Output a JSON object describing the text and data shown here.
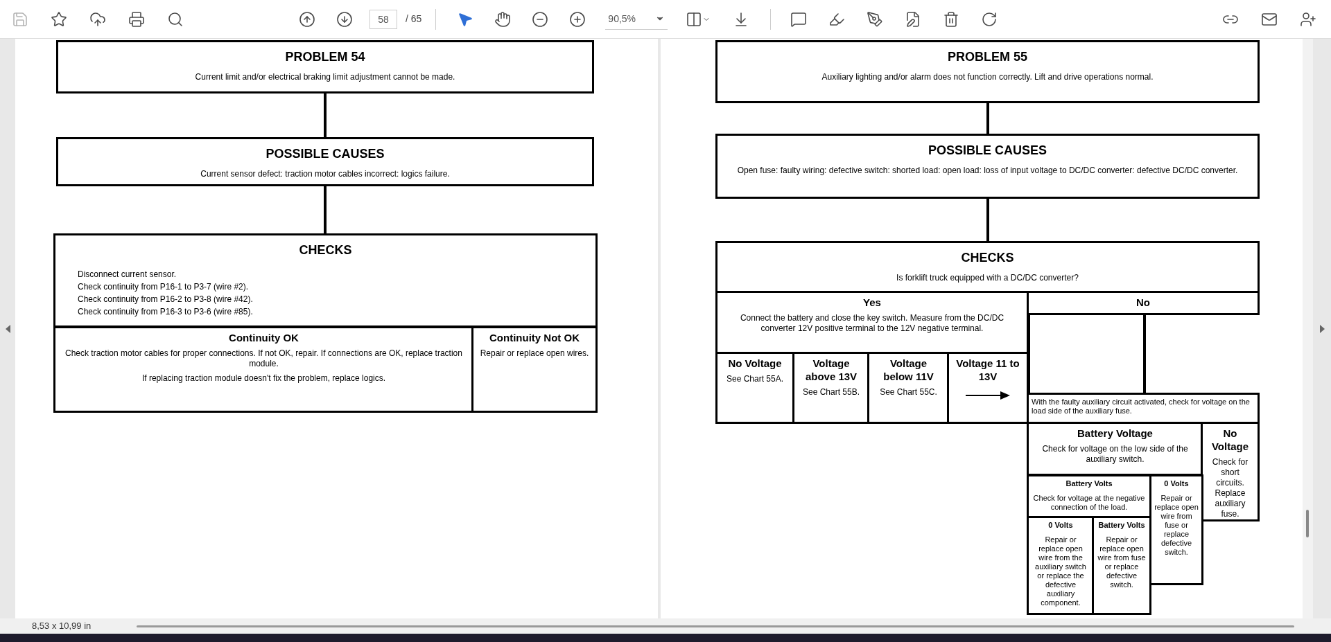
{
  "toolbar": {
    "page_field": {
      "value": "58"
    },
    "page_total": "/ 65",
    "zoom_field": {
      "value": "90,5%"
    }
  },
  "pages": [
    {
      "nodes": [
        {
          "kind": "heading",
          "title": "PROBLEM 54",
          "paragraphs": [
            "Current limit and/or electrical braking limit adjustment cannot be made."
          ]
        },
        {
          "kind": "heading",
          "title": "POSSIBLE CAUSES",
          "paragraphs": [
            "Current sensor defect: traction motor cables incorrect: logics failure."
          ]
        },
        {
          "kind": "heading",
          "title": "CHECKS",
          "lines": [
            "Disconnect current sensor.",
            "Check continuity from P16-1 to P3-7 (wire #2).",
            "Check continuity from P16-2 to P3-8 (wire #42).",
            "Check continuity from P16-3 to P3-6 (wire #85)."
          ]
        },
        {
          "kind": "branch",
          "title": "Continuity OK",
          "paragraphs": [
            "Check traction motor cables for proper connections. If not OK, repair. If connections are OK, replace traction module.",
            "If replacing traction module doesn't fix the problem, replace logics."
          ]
        },
        {
          "kind": "branch",
          "title": "Continuity Not OK",
          "paragraphs": [
            "Repair or replace open wires."
          ]
        }
      ]
    },
    {
      "nodes": [
        {
          "kind": "heading",
          "title": "PROBLEM 55",
          "paragraphs": [
            "Auxiliary lighting and/or alarm does not function correctly. Lift and drive operations normal."
          ]
        },
        {
          "kind": "heading",
          "title": "POSSIBLE CAUSES",
          "paragraphs": [
            "Open fuse: faulty wiring: defective switch: shorted load: open load: loss of input voltage to DC/DC converter: defective DC/DC converter."
          ]
        },
        {
          "kind": "heading",
          "title": "CHECKS",
          "paragraphs": [
            "Is forklift truck equipped with a DC/DC converter?"
          ]
        },
        {
          "kind": "branch",
          "title": "Yes",
          "paragraphs": [
            "Connect the battery and close the key switch. Measure from the DC/DC converter 12V positive terminal to the 12V negative terminal."
          ]
        },
        {
          "kind": "branch",
          "title": "No"
        },
        {
          "kind": "branch",
          "title": "No Voltage",
          "paragraphs": [
            "See Chart 55A."
          ]
        },
        {
          "kind": "branch",
          "title": "Voltage above 13V",
          "paragraphs": [
            "See Chart 55B."
          ]
        },
        {
          "kind": "branch",
          "title": "Voltage below 11V",
          "paragraphs": [
            "See Chart 55C."
          ]
        },
        {
          "kind": "branch",
          "title": "Voltage 11 to 13V",
          "arrow": true
        },
        {
          "kind": "small",
          "lines": [
            "With the faulty auxiliary circuit activated, check for voltage on the load side of the auxiliary fuse."
          ]
        },
        {
          "kind": "branch",
          "title": "Battery Voltage",
          "paragraphs": [
            "Check for voltage on the low side of the auxiliary switch."
          ]
        },
        {
          "kind": "branch",
          "title": "No Voltage",
          "paragraphs": [
            "Check for short circuits. Replace auxiliary fuse."
          ]
        },
        {
          "kind": "small",
          "title": "Battery Volts",
          "paragraphs": [
            "Check for voltage at the negative connection of the load."
          ]
        },
        {
          "kind": "small",
          "title": "0 Volts",
          "paragraphs": [
            "Repair or replace open wire from fuse or replace defective switch."
          ]
        },
        {
          "kind": "small",
          "title": "0 Volts",
          "paragraphs": [
            "Repair or replace open wire from the auxiliary switch or replace the defective auxiliary component."
          ]
        },
        {
          "kind": "small",
          "title": "Battery Volts",
          "paragraphs": [
            "Repair or replace open wire from fuse or replace defective switch."
          ]
        }
      ]
    }
  ],
  "status_bar": {
    "page_size": "8,53 x 10,99 in"
  }
}
